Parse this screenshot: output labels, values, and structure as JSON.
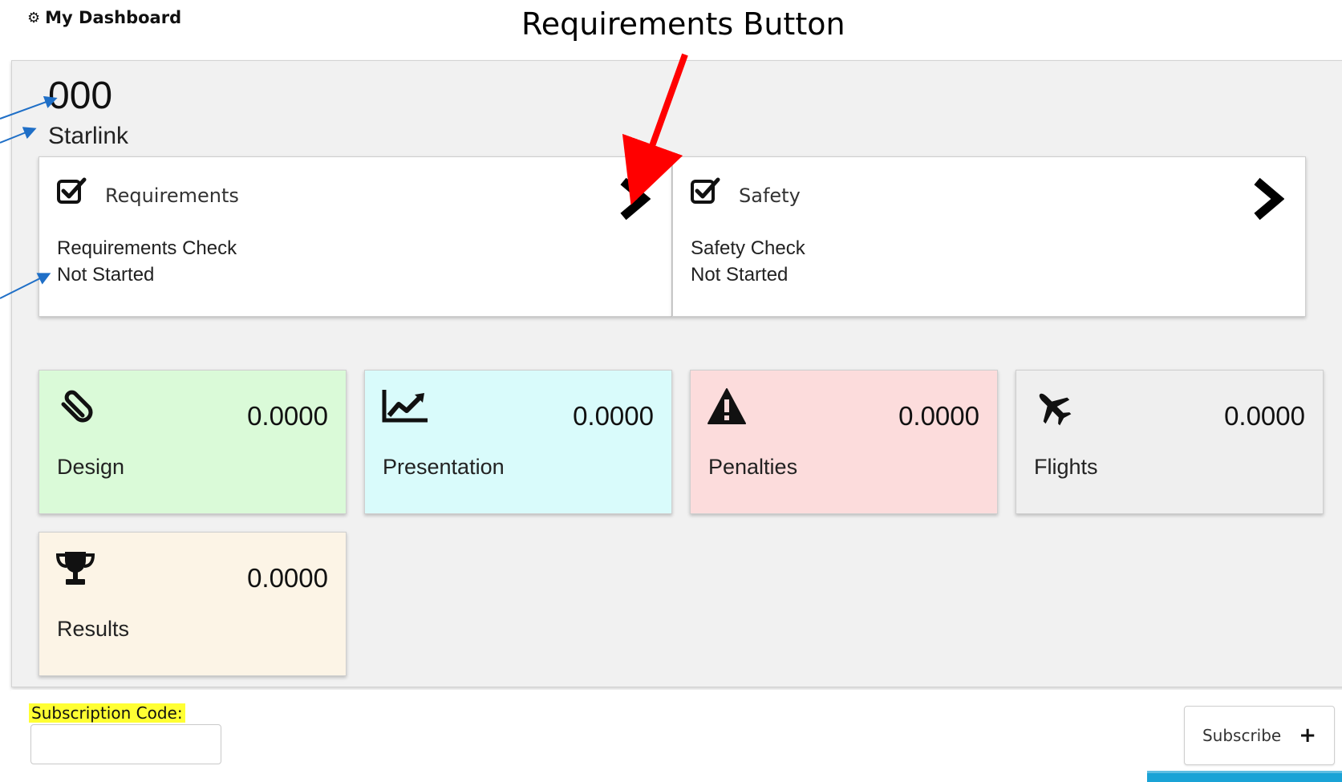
{
  "header": {
    "title": "My Dashboard",
    "icon": "dashboard-icon"
  },
  "annotation": {
    "callout": "Requirements Button",
    "arrow_color": "#ff0000",
    "pointer_color": "#1f6fc7"
  },
  "team": {
    "number": "000",
    "name": "Starlink"
  },
  "checks": [
    {
      "title": "Requirements",
      "line1": "Requirements Check",
      "line2": "Not Started",
      "icon": "checkbox-icon"
    },
    {
      "title": "Safety",
      "line1": "Safety Check",
      "line2": "Not Started",
      "icon": "checkbox-icon"
    }
  ],
  "scores": [
    {
      "label": "Design",
      "value": "0.0000",
      "color": "#dafad8",
      "icon": "paperclip-icon"
    },
    {
      "label": "Presentation",
      "value": "0.0000",
      "color": "#d9fbfb",
      "icon": "line-chart-icon"
    },
    {
      "label": "Penalties",
      "value": "0.0000",
      "color": "#fcdcdc",
      "icon": "warning-icon"
    },
    {
      "label": "Flights",
      "value": "0.0000",
      "color": "#efefef",
      "icon": "plane-icon"
    },
    {
      "label": "Results",
      "value": "0.0000",
      "color": "#fcf4e6",
      "icon": "trophy-icon"
    }
  ],
  "subscription": {
    "label": "Subscription Code:",
    "value": "",
    "button": "Subscribe",
    "highlight": "#ffff33"
  }
}
